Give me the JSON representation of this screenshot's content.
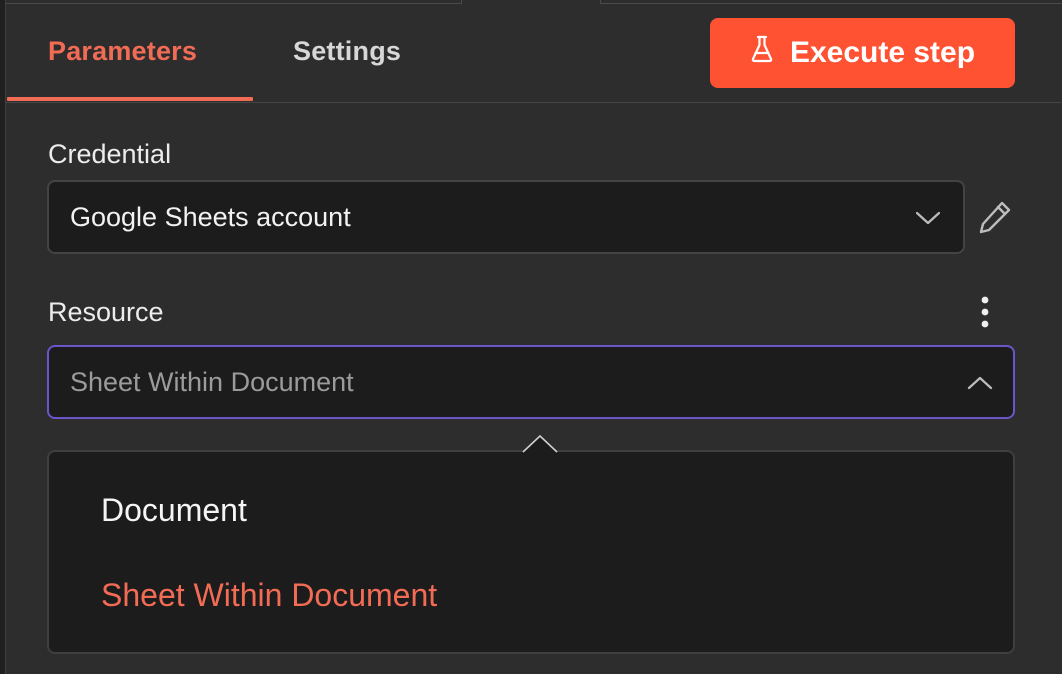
{
  "tabs": {
    "parameters": "Parameters",
    "settings": "Settings",
    "active": "parameters"
  },
  "execute_button": {
    "label": "Execute step",
    "icon": "flask-icon"
  },
  "credential": {
    "label": "Credential",
    "value": "Google Sheets account",
    "edit_icon": "pencil-icon"
  },
  "resource": {
    "label": "Resource",
    "value": "Sheet Within Document",
    "menu_icon": "kebab-icon",
    "options": [
      "Document",
      "Sheet Within Document"
    ],
    "selected_index": 1
  },
  "colors": {
    "accent": "#f26b55",
    "execute_bg": "#ff5233",
    "focus_border": "#6b55c9",
    "panel_bg": "#2d2d2d",
    "field_bg": "#1c1c1c"
  }
}
